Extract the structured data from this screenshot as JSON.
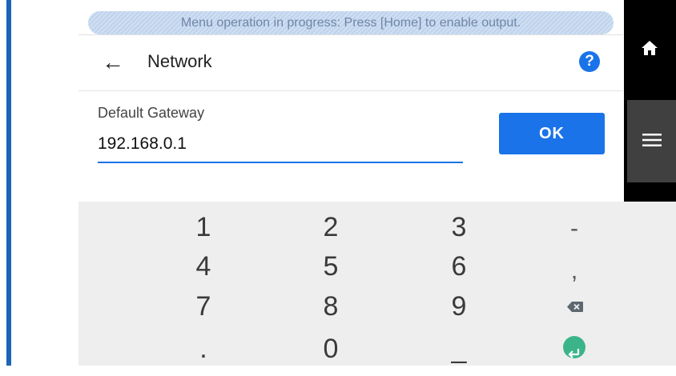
{
  "status_banner": "Menu operation in progress: Press [Home] to enable output.",
  "header": {
    "back_icon": "arrow-left-icon",
    "title": "Network",
    "help_icon": "question-circle-icon"
  },
  "field": {
    "label": "Default Gateway",
    "value": "192.168.0.1"
  },
  "ok_label": "OK",
  "side_nav": {
    "home_icon": "home-icon",
    "menu_icon": "hamburger-menu-icon"
  },
  "keyboard": {
    "row1": [
      "1",
      "2",
      "3",
      "-"
    ],
    "row2": [
      "4",
      "5",
      "6",
      ","
    ],
    "row3": [
      "7",
      "8",
      "9"
    ],
    "row4": [
      ".",
      "0",
      "_"
    ],
    "backspace_icon": "backspace-icon",
    "enter_icon": "enter-icon"
  },
  "colors": {
    "accent": "#1a73e8",
    "sidebar": "#000000",
    "menu": "#404040",
    "keyboard_bg": "#eeeeee",
    "enter": "#3cb48a"
  }
}
